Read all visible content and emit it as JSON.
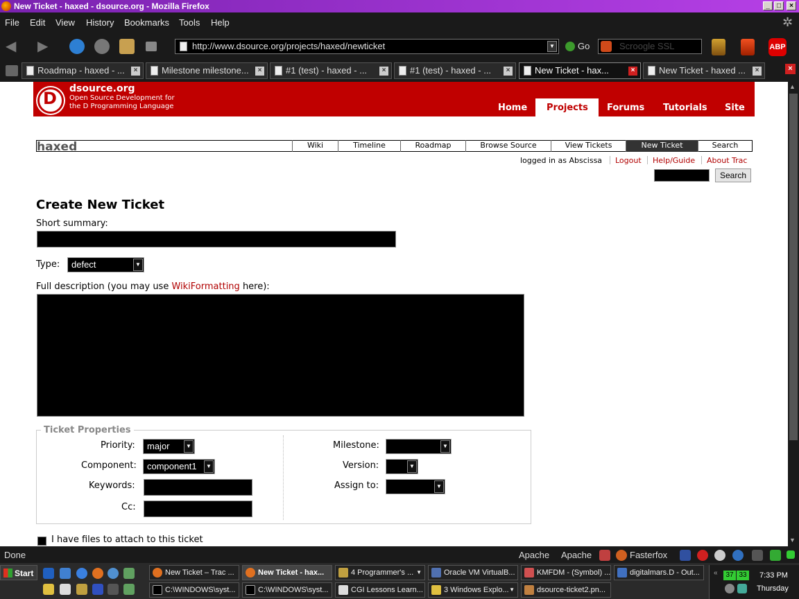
{
  "window": {
    "title": "New Ticket - haxed - dsource.org - Mozilla Firefox"
  },
  "menu": [
    "File",
    "Edit",
    "View",
    "History",
    "Bookmarks",
    "Tools",
    "Help"
  ],
  "nav": {
    "url": "http://www.dsource.org/projects/haxed/newticket",
    "go_label": "Go",
    "search_placeholder": "Scroogle SSL"
  },
  "tabs": [
    {
      "label": "Roadmap - haxed - ..."
    },
    {
      "label": "Milestone milestone..."
    },
    {
      "label": "#1 (test) - haxed - ..."
    },
    {
      "label": "#1 (test) - haxed - ..."
    },
    {
      "label": "New Ticket - hax..."
    },
    {
      "label": "New Ticket - haxed ..."
    }
  ],
  "site": {
    "name": "dsource.org",
    "tagline1": "Open Source Development for",
    "tagline2": "the D Programming Language",
    "nav": [
      "Home",
      "Projects",
      "Forums",
      "Tutorials",
      "Site"
    ]
  },
  "project": {
    "name": "haxed",
    "nav": [
      "Wiki",
      "Timeline",
      "Roadmap",
      "Browse Source",
      "View Tickets",
      "New Ticket",
      "Search"
    ]
  },
  "meta": {
    "logged_in": "logged in as Abscissa",
    "logout": "Logout",
    "help": "Help/Guide",
    "about": "About Trac",
    "search_button": "Search"
  },
  "form": {
    "heading": "Create New Ticket",
    "summary_label": "Short summary:",
    "type_label": "Type:",
    "type_value": "defect",
    "desc_label_pre": "Full description (you may use ",
    "desc_link": "WikiFormatting",
    "desc_label_post": " here):",
    "props_legend": "Ticket Properties",
    "priority_label": "Priority:",
    "priority_value": "major",
    "component_label": "Component:",
    "component_value": "component1",
    "keywords_label": "Keywords:",
    "cc_label": "Cc:",
    "milestone_label": "Milestone:",
    "version_label": "Version:",
    "assign_label": "Assign to:",
    "attach_label": "I have files to attach to this ticket"
  },
  "status": {
    "text": "Done",
    "items": [
      "Apache",
      "Apache",
      "Fasterfox"
    ]
  },
  "taskbar": {
    "start": "Start",
    "tasks_row1": [
      "New Ticket – Trac ...",
      "New Ticket - hax...",
      "4 Programmer's ...",
      "Oracle VM VirtualB...",
      "KMFDM - (Symbol) ...",
      "digitalmars.D - Out..."
    ],
    "tasks_row2": [
      "C:\\WINDOWS\\syst...",
      "C:\\WINDOWS\\syst...",
      "CGI Lessons Learn...",
      "3 Windows Explo...",
      "dsource-ticket2.pn..."
    ],
    "clock_time": "7:33 PM",
    "clock_day": "Thursday",
    "tray_left": "37",
    "tray_right": "33"
  }
}
